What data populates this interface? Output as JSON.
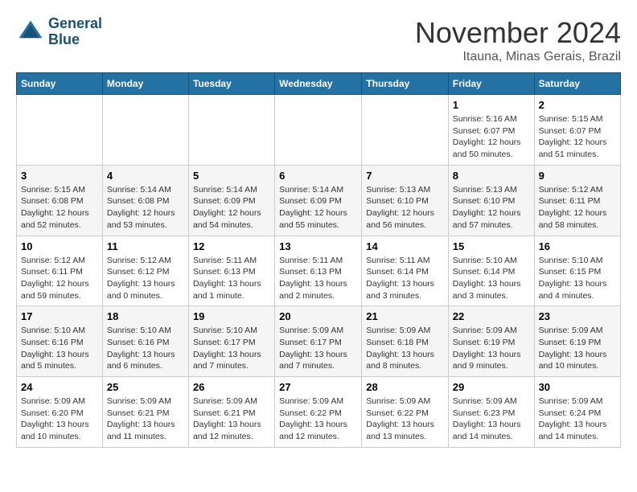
{
  "logo": {
    "line1": "General",
    "line2": "Blue"
  },
  "title": "November 2024",
  "location": "Itauna, Minas Gerais, Brazil",
  "days_of_week": [
    "Sunday",
    "Monday",
    "Tuesday",
    "Wednesday",
    "Thursday",
    "Friday",
    "Saturday"
  ],
  "weeks": [
    [
      {
        "day": "",
        "info": ""
      },
      {
        "day": "",
        "info": ""
      },
      {
        "day": "",
        "info": ""
      },
      {
        "day": "",
        "info": ""
      },
      {
        "day": "",
        "info": ""
      },
      {
        "day": "1",
        "info": "Sunrise: 5:16 AM\nSunset: 6:07 PM\nDaylight: 12 hours\nand 50 minutes."
      },
      {
        "day": "2",
        "info": "Sunrise: 5:15 AM\nSunset: 6:07 PM\nDaylight: 12 hours\nand 51 minutes."
      }
    ],
    [
      {
        "day": "3",
        "info": "Sunrise: 5:15 AM\nSunset: 6:08 PM\nDaylight: 12 hours\nand 52 minutes."
      },
      {
        "day": "4",
        "info": "Sunrise: 5:14 AM\nSunset: 6:08 PM\nDaylight: 12 hours\nand 53 minutes."
      },
      {
        "day": "5",
        "info": "Sunrise: 5:14 AM\nSunset: 6:09 PM\nDaylight: 12 hours\nand 54 minutes."
      },
      {
        "day": "6",
        "info": "Sunrise: 5:14 AM\nSunset: 6:09 PM\nDaylight: 12 hours\nand 55 minutes."
      },
      {
        "day": "7",
        "info": "Sunrise: 5:13 AM\nSunset: 6:10 PM\nDaylight: 12 hours\nand 56 minutes."
      },
      {
        "day": "8",
        "info": "Sunrise: 5:13 AM\nSunset: 6:10 PM\nDaylight: 12 hours\nand 57 minutes."
      },
      {
        "day": "9",
        "info": "Sunrise: 5:12 AM\nSunset: 6:11 PM\nDaylight: 12 hours\nand 58 minutes."
      }
    ],
    [
      {
        "day": "10",
        "info": "Sunrise: 5:12 AM\nSunset: 6:11 PM\nDaylight: 12 hours\nand 59 minutes."
      },
      {
        "day": "11",
        "info": "Sunrise: 5:12 AM\nSunset: 6:12 PM\nDaylight: 13 hours\nand 0 minutes."
      },
      {
        "day": "12",
        "info": "Sunrise: 5:11 AM\nSunset: 6:13 PM\nDaylight: 13 hours\nand 1 minute."
      },
      {
        "day": "13",
        "info": "Sunrise: 5:11 AM\nSunset: 6:13 PM\nDaylight: 13 hours\nand 2 minutes."
      },
      {
        "day": "14",
        "info": "Sunrise: 5:11 AM\nSunset: 6:14 PM\nDaylight: 13 hours\nand 3 minutes."
      },
      {
        "day": "15",
        "info": "Sunrise: 5:10 AM\nSunset: 6:14 PM\nDaylight: 13 hours\nand 3 minutes."
      },
      {
        "day": "16",
        "info": "Sunrise: 5:10 AM\nSunset: 6:15 PM\nDaylight: 13 hours\nand 4 minutes."
      }
    ],
    [
      {
        "day": "17",
        "info": "Sunrise: 5:10 AM\nSunset: 6:16 PM\nDaylight: 13 hours\nand 5 minutes."
      },
      {
        "day": "18",
        "info": "Sunrise: 5:10 AM\nSunset: 6:16 PM\nDaylight: 13 hours\nand 6 minutes."
      },
      {
        "day": "19",
        "info": "Sunrise: 5:10 AM\nSunset: 6:17 PM\nDaylight: 13 hours\nand 7 minutes."
      },
      {
        "day": "20",
        "info": "Sunrise: 5:09 AM\nSunset: 6:17 PM\nDaylight: 13 hours\nand 7 minutes."
      },
      {
        "day": "21",
        "info": "Sunrise: 5:09 AM\nSunset: 6:18 PM\nDaylight: 13 hours\nand 8 minutes."
      },
      {
        "day": "22",
        "info": "Sunrise: 5:09 AM\nSunset: 6:19 PM\nDaylight: 13 hours\nand 9 minutes."
      },
      {
        "day": "23",
        "info": "Sunrise: 5:09 AM\nSunset: 6:19 PM\nDaylight: 13 hours\nand 10 minutes."
      }
    ],
    [
      {
        "day": "24",
        "info": "Sunrise: 5:09 AM\nSunset: 6:20 PM\nDaylight: 13 hours\nand 10 minutes."
      },
      {
        "day": "25",
        "info": "Sunrise: 5:09 AM\nSunset: 6:21 PM\nDaylight: 13 hours\nand 11 minutes."
      },
      {
        "day": "26",
        "info": "Sunrise: 5:09 AM\nSunset: 6:21 PM\nDaylight: 13 hours\nand 12 minutes."
      },
      {
        "day": "27",
        "info": "Sunrise: 5:09 AM\nSunset: 6:22 PM\nDaylight: 13 hours\nand 12 minutes."
      },
      {
        "day": "28",
        "info": "Sunrise: 5:09 AM\nSunset: 6:22 PM\nDaylight: 13 hours\nand 13 minutes."
      },
      {
        "day": "29",
        "info": "Sunrise: 5:09 AM\nSunset: 6:23 PM\nDaylight: 13 hours\nand 14 minutes."
      },
      {
        "day": "30",
        "info": "Sunrise: 5:09 AM\nSunset: 6:24 PM\nDaylight: 13 hours\nand 14 minutes."
      }
    ]
  ]
}
